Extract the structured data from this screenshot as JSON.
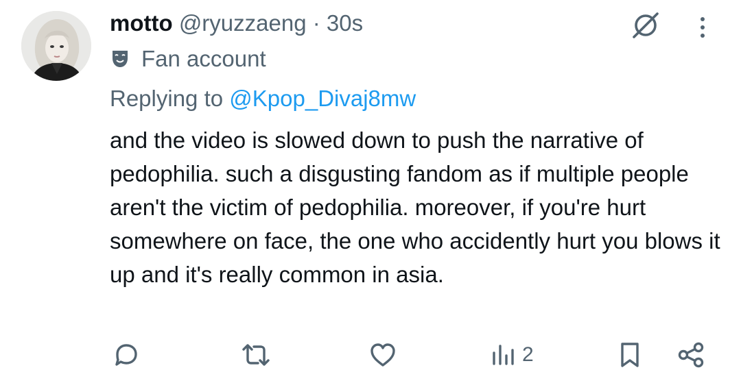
{
  "tweet": {
    "display_name": "motto",
    "handle": "@ryuzzaeng",
    "separator": "·",
    "time": "30s",
    "badge_label": "Fan account",
    "reply_prefix": "Replying to",
    "reply_handle": "@Kpop_Divaj8mw",
    "text": "and the video is slowed down to push the narrative of pedophilia. such a disgusting fandom as if multiple people aren't the victim of pedophilia. moreover, if you're hurt somewhere on face, the one who accidently hurt you blows it up and it's really common in asia."
  },
  "actions": {
    "views_count": "2"
  },
  "icons": {
    "badge": "theater-mask-icon",
    "grok": "grok-icon",
    "more": "more-vertical-icon",
    "reply": "reply-icon",
    "repost": "repost-icon",
    "like": "heart-icon",
    "views": "analytics-icon",
    "bookmark": "bookmark-icon",
    "share": "share-icon"
  },
  "colors": {
    "text": "#0f1419",
    "secondary": "#536471",
    "link": "#1d9bf0"
  }
}
